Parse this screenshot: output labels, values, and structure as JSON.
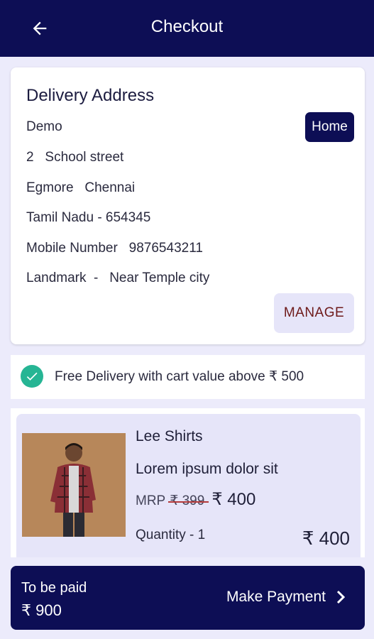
{
  "appbar": {
    "title": "Checkout",
    "back_icon": "arrow-left-icon"
  },
  "address": {
    "heading": "Delivery Address",
    "name": "Demo",
    "line1": "2   School street",
    "line2": "Egmore   Chennai",
    "line3": "Tamil Nadu - 654345",
    "mobile": "Mobile Number   9876543211",
    "landmark": "Landmark  -   Near Temple city",
    "tag": "Home",
    "manage_label": "MANAGE"
  },
  "delivery": {
    "text": "Free Delivery with cart value above ₹ 500",
    "icon": "check-circle-icon"
  },
  "product": {
    "name": "Lee Shirts",
    "description": "Lorem ipsum dolor sit",
    "mrp_label": "MRP",
    "mrp_old": "₹ 399",
    "price": "₹ 400",
    "quantity": "Quantity - 1",
    "line_total": "₹ 400"
  },
  "payment": {
    "to_be_paid_label": "To be paid",
    "amount": "₹ 900",
    "action_label": "Make Payment",
    "action_icon": "chevron-right-icon"
  },
  "colors": {
    "primary": "#0d0e55",
    "accent_green": "#26b594",
    "surface": "#ecebfb"
  }
}
